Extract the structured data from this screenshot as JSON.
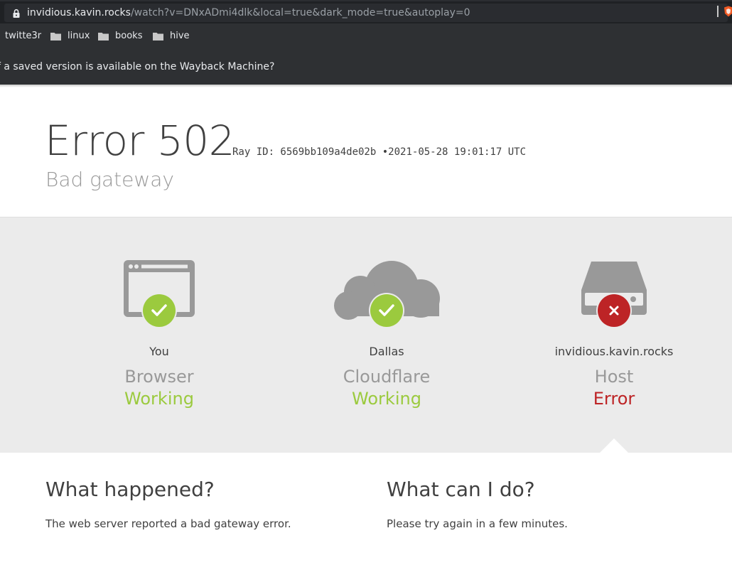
{
  "browser": {
    "url_host": "invidious.kavin.rocks",
    "url_rest": "/watch?v=DNxADmi4dlk&local=true&dark_mode=true&autoplay=0",
    "bookmarks": [
      {
        "label": "twitte3r",
        "folder": false
      },
      {
        "label": "linux",
        "folder": true
      },
      {
        "label": "books",
        "folder": true
      },
      {
        "label": "hive",
        "folder": true
      }
    ],
    "infobar_text": "f a saved version is available on the Wayback Machine?"
  },
  "error": {
    "code": "Error 502",
    "ray": "Ray ID: 6569bb109a4de02b",
    "bullet": "•",
    "timestamp": "2021-05-28 19:01:17 UTC",
    "subtitle": "Bad gateway"
  },
  "status": [
    {
      "location": "You",
      "what": "Browser",
      "state": "Working",
      "ok": true,
      "icon": "browser-icon"
    },
    {
      "location": "Dallas",
      "what": "Cloudflare",
      "state": "Working",
      "ok": true,
      "icon": "cloud-icon"
    },
    {
      "location": "invidious.kavin.rocks",
      "what": "Host",
      "state": "Error",
      "ok": false,
      "icon": "server-icon"
    }
  ],
  "colors": {
    "ok": "#9bca3e",
    "error": "#bd2426",
    "icon_gray": "#999999"
  },
  "info": {
    "happened_title": "What happened?",
    "happened_text": "The web server reported a bad gateway error.",
    "cando_title": "What can I do?",
    "cando_text": "Please try again in a few minutes."
  }
}
